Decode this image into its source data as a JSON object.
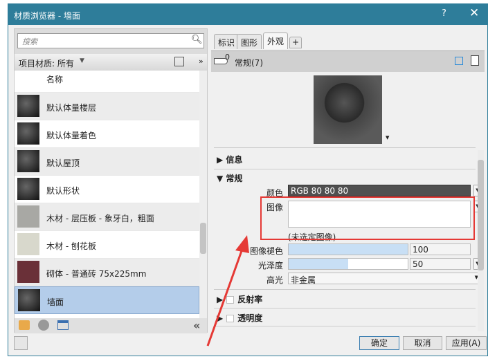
{
  "window": {
    "title": "材质浏览器 - 墙面",
    "help": "?",
    "close": "✕"
  },
  "left": {
    "search_placeholder": "搜索",
    "filter_label": "项目材质: 所有",
    "column_header": "名称",
    "materials": [
      {
        "name": "默认体量楼层",
        "thumb": "#333"
      },
      {
        "name": "默认体量着色",
        "thumb": "#333"
      },
      {
        "name": "默认屋顶",
        "thumb": "#333"
      },
      {
        "name": "默认形状",
        "thumb": "#333"
      },
      {
        "name": "木材 - 层压板 - 象牙白，粗面",
        "thumb": "#a8a8a4"
      },
      {
        "name": "木材 - 刨花板",
        "thumb": "#d8d8cc"
      },
      {
        "name": "砌体 - 普通砖 75x225mm",
        "thumb": "#6a3038"
      },
      {
        "name": "墙面",
        "thumb": "#333",
        "selected": true
      }
    ],
    "collapse": "«"
  },
  "right": {
    "tabs": [
      "标识",
      "图形",
      "外观",
      "+"
    ],
    "active_tab": "外观",
    "asset_count": "0",
    "asset_name": "常规(7)",
    "sections": {
      "info": "信息",
      "general": "常规",
      "reflectivity": "反射率",
      "transparency": "透明度"
    },
    "props": {
      "color_label": "颜色",
      "color_value": "RGB 80 80 80",
      "color_hex": "#505050",
      "image_label": "图像",
      "image_status": "(未选定图像)",
      "fade_label": "图像褪色",
      "fade_value": "100",
      "fade_percent": 100,
      "gloss_label": "光泽度",
      "gloss_value": "50",
      "gloss_percent": 50,
      "highlight_label": "高光",
      "highlight_value": "非金属"
    }
  },
  "buttons": {
    "ok": "确定",
    "cancel": "取消",
    "apply": "应用(A)"
  },
  "colors": {
    "titlebar": "#2e7d9a",
    "selection": "#b4cdea",
    "annotation": "#e53935"
  }
}
